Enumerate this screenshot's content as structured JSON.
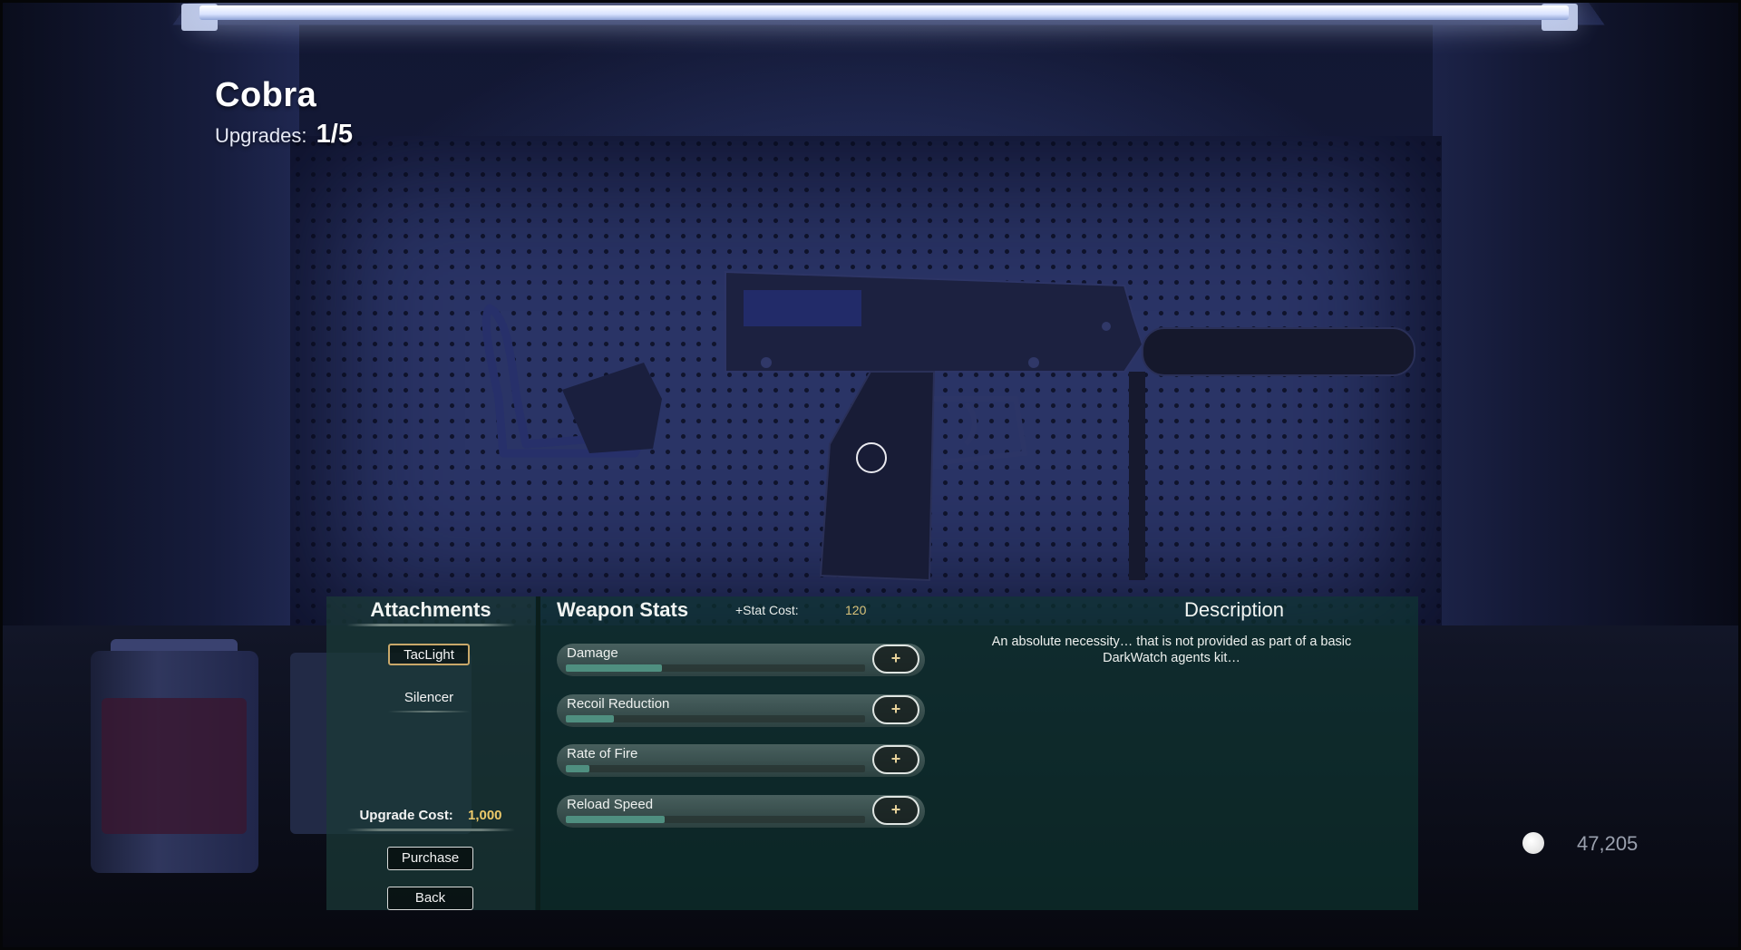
{
  "weapon": {
    "name": "Cobra",
    "upgrades_label": "Upgrades:",
    "upgrades_value": "1/5"
  },
  "attachments": {
    "title": "Attachments",
    "items": [
      {
        "label": "TacLight",
        "selected": true
      },
      {
        "label": "Silencer",
        "selected": false
      }
    ],
    "upgrade_cost_label": "Upgrade Cost:",
    "upgrade_cost_value": "1,000",
    "purchase_label": "Purchase",
    "back_label": "Back"
  },
  "stats": {
    "title": "Weapon Stats",
    "stat_cost_label": "+Stat Cost:",
    "stat_cost_value": "120",
    "items": [
      {
        "label": "Damage",
        "fill": 0.32
      },
      {
        "label": "Recoil Reduction",
        "fill": 0.16
      },
      {
        "label": "Rate of Fire",
        "fill": 0.08
      },
      {
        "label": "Reload Speed",
        "fill": 0.33
      }
    ],
    "plus_symbol": "+"
  },
  "description": {
    "title": "Description",
    "text": "An absolute necessity… that is not provided as part of a basic DarkWatch agents kit…"
  },
  "currency": {
    "amount": "47,205",
    "icon": "coin-icon"
  },
  "colors": {
    "accent_gold": "#ecc96a",
    "stat_fill": "#4f8f80",
    "panel": "#0e3832"
  }
}
